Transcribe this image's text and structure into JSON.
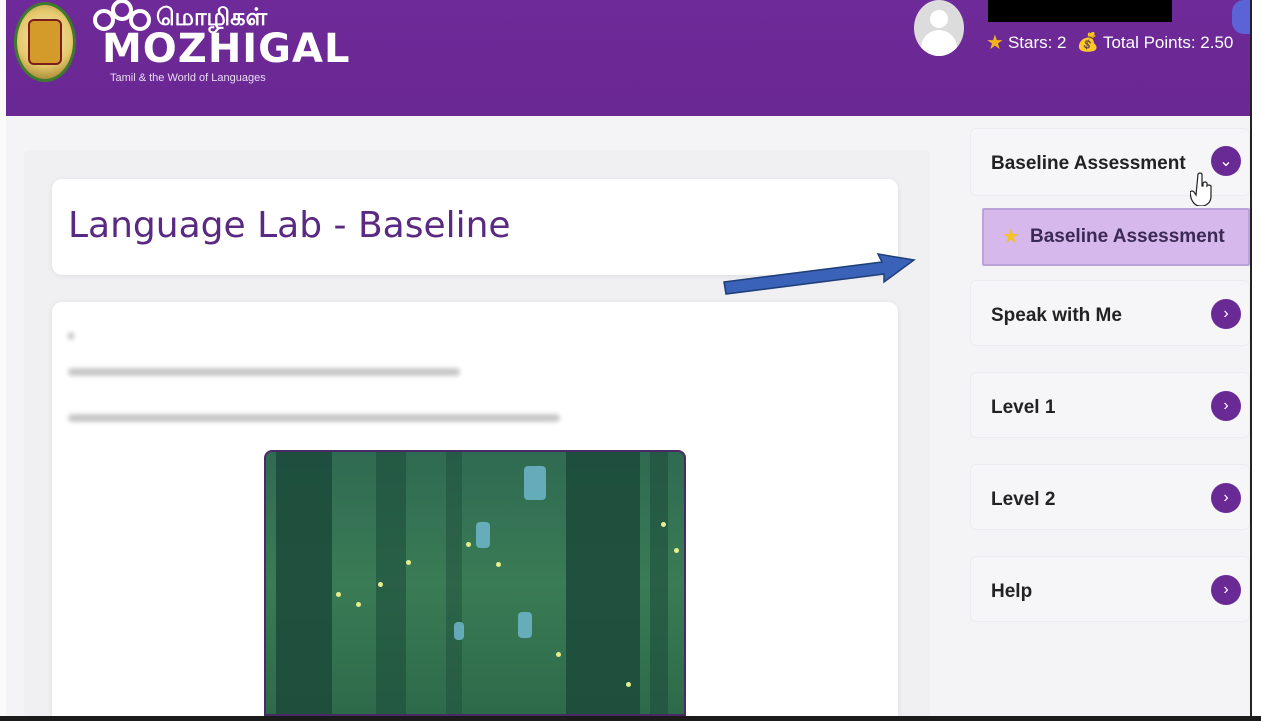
{
  "header": {
    "logo_tamil": "மொழிகள்",
    "logo_name": "MOZHIGAL",
    "logo_tagline": "Tamil & the World of Languages",
    "stars_text": "Stars: 2",
    "points_text": "Total Points: 2.50",
    "brand_color": "#6a2894"
  },
  "main": {
    "page_title": "Language Lab - Baseline"
  },
  "sidebar": {
    "items": [
      {
        "label": "Baseline Assessment",
        "icon": "chevron-down-icon"
      },
      {
        "label": "Speak with Me",
        "icon": "chevron-right-icon"
      },
      {
        "label": "Level 1",
        "icon": "chevron-right-icon"
      },
      {
        "label": "Level 2",
        "icon": "chevron-right-icon"
      },
      {
        "label": "Help",
        "icon": "chevron-right-icon"
      }
    ],
    "active_subitem": {
      "label": "Baseline Assessment",
      "icon": "star-icon"
    },
    "accent_color": "#6a2a96",
    "highlight_color": "#d6b8ec"
  }
}
